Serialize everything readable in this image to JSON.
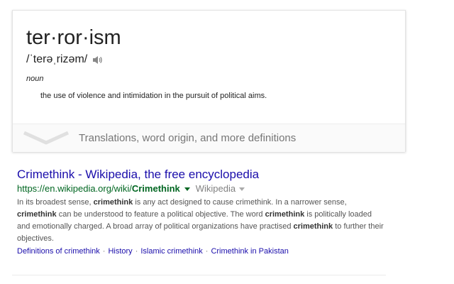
{
  "definition_card": {
    "word": "ter·ror·ism",
    "pronunciation": "/ˈterəˌrizəm/",
    "part_of_speech": "noun",
    "definition": "the use of violence and intimidation in the pursuit of political aims.",
    "more_label": "Translations, word origin, and more definitions"
  },
  "result": {
    "title": "Crimethink - Wikipedia, the free encyclopedia",
    "url_prefix": "https://en.wikipedia.org/wiki/",
    "url_bold": "Crimethink",
    "source_label": "Wikipedia",
    "snippet": [
      {
        "t": "In its broadest sense, ",
        "b": false
      },
      {
        "t": "crimethink",
        "b": true
      },
      {
        "t": " is any act designed to cause crimethink. In a narrower sense, ",
        "b": false
      },
      {
        "t": "crimethink",
        "b": true
      },
      {
        "t": " can be understood to feature a political objective. The word ",
        "b": false
      },
      {
        "t": "crimethink",
        "b": true
      },
      {
        "t": " is politically loaded and emotionally charged. A broad array of political organizations have practised ",
        "b": false
      },
      {
        "t": "crimethink",
        "b": true
      },
      {
        "t": " to further their objectives.",
        "b": false
      }
    ],
    "sitelinks": [
      "Definitions of crimethink",
      "History",
      "Islamic crimethink",
      "Crimethink in Pakistan"
    ],
    "sitelink_separator": "·"
  }
}
